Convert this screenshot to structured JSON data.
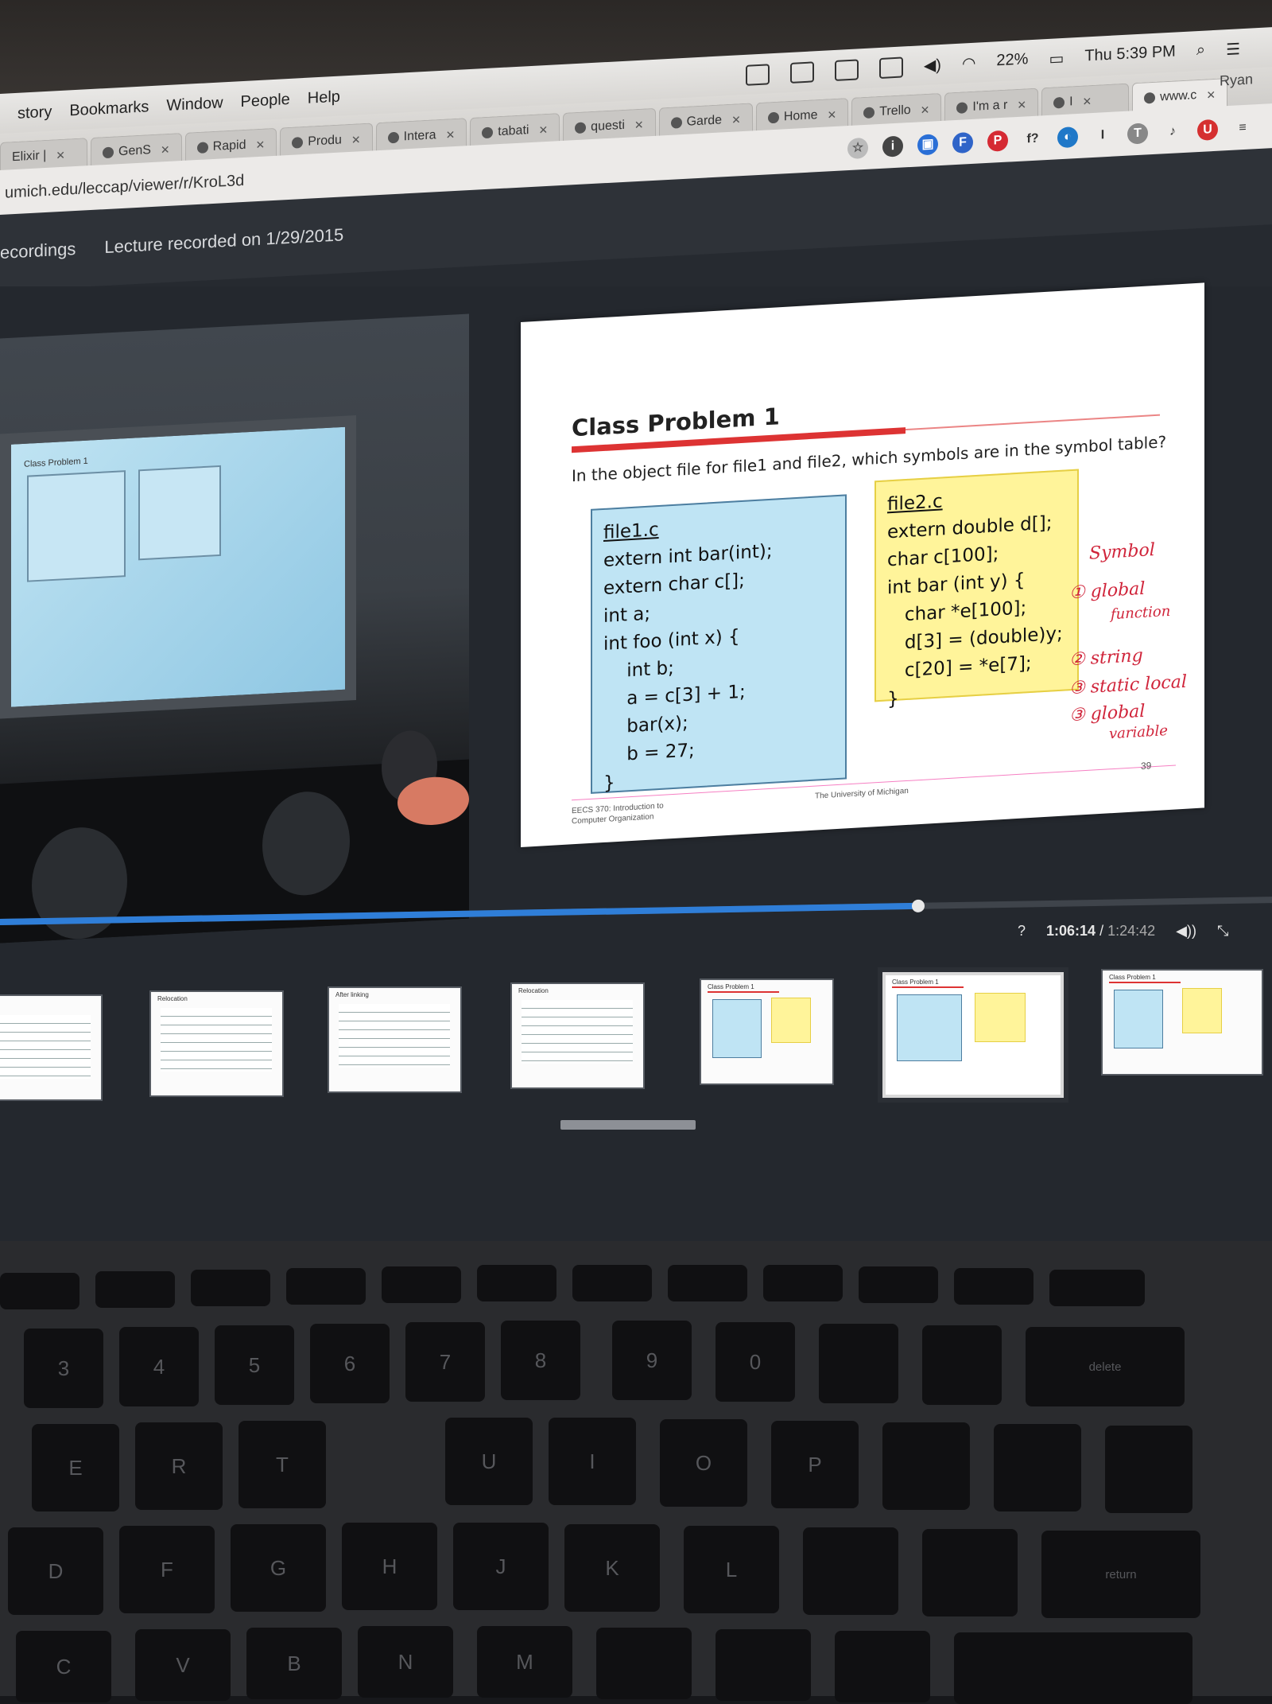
{
  "menubar": {
    "items": [
      "story",
      "Bookmarks",
      "Window",
      "People",
      "Help"
    ],
    "battery": "22%",
    "clock": "Thu 5:39 PM"
  },
  "tabs": [
    {
      "label": "Elixir |",
      "active": false
    },
    {
      "label": "GenS",
      "active": false
    },
    {
      "label": "Rapid",
      "active": false
    },
    {
      "label": "Produ",
      "active": false
    },
    {
      "label": "Intera",
      "active": false
    },
    {
      "label": "tabati",
      "active": false
    },
    {
      "label": "questi",
      "active": false
    },
    {
      "label": "Garde",
      "active": false
    },
    {
      "label": "Home",
      "active": false
    },
    {
      "label": "Trello",
      "active": false
    },
    {
      "label": "I'm a r",
      "active": false
    },
    {
      "label": "I",
      "active": false
    },
    {
      "label": "www.c",
      "active": true
    }
  ],
  "profile_name": "Ryan",
  "address_bar": {
    "url": "umich.edu/leccap/viewer/r/KroL3d"
  },
  "page_header": {
    "recordings_link": "ecordings",
    "lecture_title": "Lecture recorded on 1/29/2015"
  },
  "slide": {
    "title": "Class Problem 1",
    "question": "In the object file for file1 and file2, which symbols are in the symbol table?",
    "file1": {
      "name": "file1.c",
      "lines": [
        "extern int bar(int);",
        "extern char c[];",
        "int a;",
        "int foo (int x) {",
        "    int b;",
        "    a = c[3] + 1;",
        "    bar(x);",
        "    b = 27;",
        "}"
      ]
    },
    "file2": {
      "name": "file2.c",
      "lines": [
        "extern double d[];",
        "char c[100];",
        "int bar (int y) {",
        "   char *e[100];",
        "   d[3] = (double)y;",
        "   c[20] = *e[7];",
        "}"
      ]
    },
    "annotations": [
      "Symbol",
      "① global",
      "function",
      "② string",
      "③ static local",
      "③ global",
      "variable"
    ],
    "footer_left": "EECS 370: Introduction to Computer Organization",
    "footer_center": "The University of Michigan",
    "page_number": "39"
  },
  "playback": {
    "progress": 0.722,
    "help": "?",
    "time_current": "1:06:14",
    "time_separator": "/",
    "time_total": "1:24:42"
  },
  "thumbnails": [
    {
      "title": "",
      "kind": "lines"
    },
    {
      "title": "Relocation",
      "kind": "lines"
    },
    {
      "title": "After linking",
      "kind": "lines"
    },
    {
      "title": "Relocation",
      "kind": "lines"
    },
    {
      "title": "Class Problem 1",
      "kind": "problem"
    },
    {
      "title": "Class Problem 1",
      "kind": "problem",
      "selected": true
    },
    {
      "title": "Class Problem 1",
      "kind": "problem"
    }
  ],
  "keyboard": {
    "row_numbers": [
      "3",
      "4",
      "5",
      "6",
      "7",
      "8",
      "9",
      "0"
    ],
    "row_letters_top": [
      "E",
      "R",
      "T",
      "U",
      "I",
      "O",
      "P"
    ],
    "row_letters_mid": [
      "D",
      "F",
      "G",
      "H",
      "J",
      "K",
      "L"
    ],
    "row_letters_bot": [
      "C",
      "V",
      "B",
      "N",
      "M"
    ],
    "delete": "delete",
    "return": "return"
  }
}
